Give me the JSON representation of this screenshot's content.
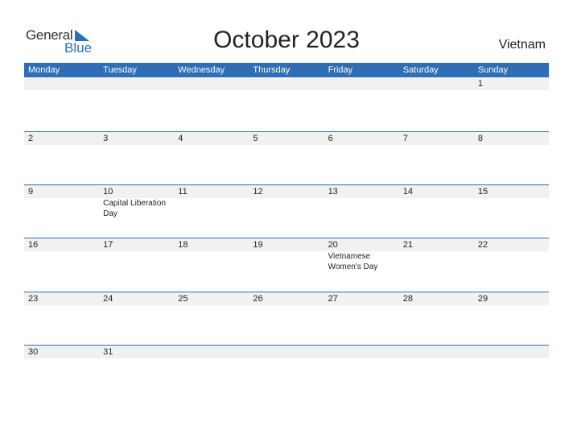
{
  "logo": {
    "general": "General",
    "blue": "Blue"
  },
  "title": "October 2023",
  "country": "Vietnam",
  "colors": {
    "accent": "#2f6db4",
    "band": "#f1f1f1"
  },
  "weekdays": [
    "Monday",
    "Tuesday",
    "Wednesday",
    "Thursday",
    "Friday",
    "Saturday",
    "Sunday"
  ],
  "weeks": [
    {
      "days": [
        "",
        "",
        "",
        "",
        "",
        "",
        "1"
      ],
      "events": [
        "",
        "",
        "",
        "",
        "",
        "",
        ""
      ]
    },
    {
      "days": [
        "2",
        "3",
        "4",
        "5",
        "6",
        "7",
        "8"
      ],
      "events": [
        "",
        "",
        "",
        "",
        "",
        "",
        ""
      ]
    },
    {
      "days": [
        "9",
        "10",
        "11",
        "12",
        "13",
        "14",
        "15"
      ],
      "events": [
        "",
        "Capital Liberation Day",
        "",
        "",
        "",
        "",
        ""
      ]
    },
    {
      "days": [
        "16",
        "17",
        "18",
        "19",
        "20",
        "21",
        "22"
      ],
      "events": [
        "",
        "",
        "",
        "",
        "Vietnamese Women's Day",
        "",
        ""
      ]
    },
    {
      "days": [
        "23",
        "24",
        "25",
        "26",
        "27",
        "28",
        "29"
      ],
      "events": [
        "",
        "",
        "",
        "",
        "",
        "",
        ""
      ]
    },
    {
      "days": [
        "30",
        "31",
        "",
        "",
        "",
        "",
        ""
      ],
      "events": [
        "",
        "",
        "",
        "",
        "",
        "",
        ""
      ]
    }
  ]
}
